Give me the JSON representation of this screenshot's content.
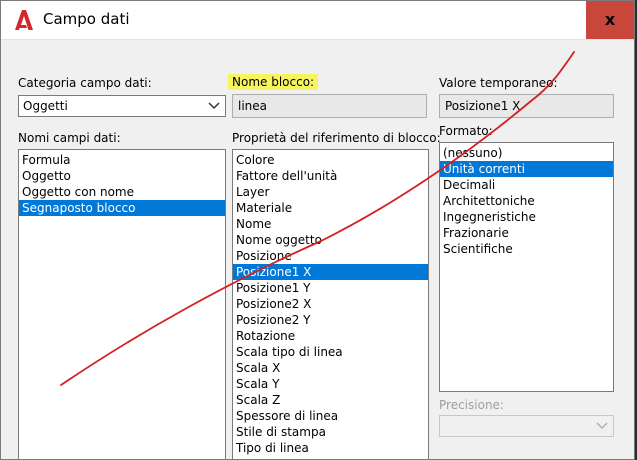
{
  "window": {
    "title": "Campo dati",
    "close_label": "x"
  },
  "category": {
    "label": "Categoria campo dati:",
    "value": "Oggetti"
  },
  "field_names": {
    "label": "Nomi campi dati:",
    "items": [
      "Formula",
      "Oggetto",
      "Oggetto con nome",
      "Segnaposto blocco"
    ],
    "selected": 3
  },
  "block_name": {
    "label": "Nome blocco:",
    "value": "linea"
  },
  "block_ref_props": {
    "label": "Proprietà del riferimento di blocco:",
    "items": [
      "Colore",
      "Fattore dell'unità",
      "Layer",
      "Materiale",
      "Nome",
      "Nome oggetto",
      "Posizione",
      "Posizione1 X",
      "Posizione1 Y",
      "Posizione2 X",
      "Posizione2 Y",
      "Rotazione",
      "Scala tipo di linea",
      "Scala X",
      "Scala Y",
      "Scala Z",
      "Spessore di linea",
      "Stile di stampa",
      "Tipo di linea"
    ],
    "selected": 7
  },
  "temp_value": {
    "label": "Valore temporaneo:",
    "value": "Posizione1 X"
  },
  "format": {
    "label": "Formato:",
    "items": [
      "(nessuno)",
      "Unità correnti",
      "Decimali",
      "Architettoniche",
      "Ingegneristiche",
      "Frazionarie",
      "Scientifiche"
    ],
    "selected": 1
  },
  "precision": {
    "label": "Precisione:",
    "value": ""
  },
  "colors": {
    "selection": "#0078d7",
    "highlight": "#f6f45f",
    "close_button": "#c9463d",
    "annotation": "#d42020",
    "app_icon": "#d6262b"
  },
  "icons": {
    "app": "autocad-logo-icon",
    "dropdown": "chevron-down-icon"
  }
}
